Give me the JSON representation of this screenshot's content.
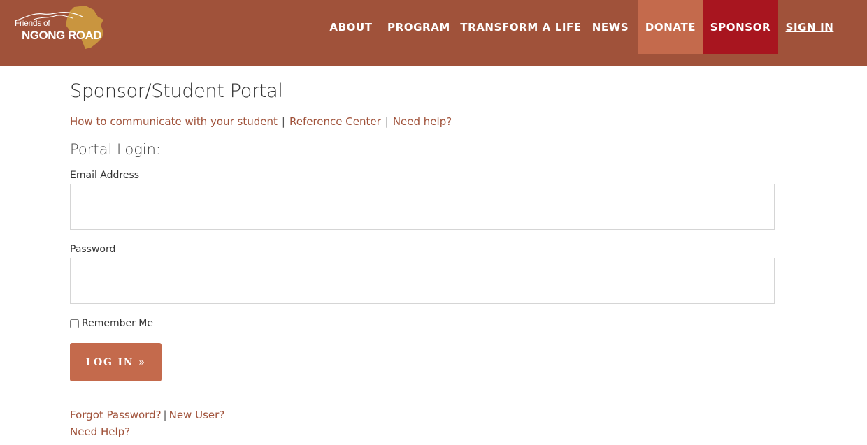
{
  "brand": {
    "line1": "Friends of",
    "line2": "NGONG ROAD",
    "colors": {
      "header": "#a0523a",
      "donate": "#c46a4c",
      "sponsor": "#a8151f",
      "logo_map": "#c9953f"
    }
  },
  "nav": {
    "items": [
      "ABOUT",
      "PROGRAM",
      "TRANSFORM A LIFE",
      "NEWS",
      "DONATE",
      "SPONSOR",
      "SIGN IN"
    ]
  },
  "page": {
    "title": "Sponsor/Student Portal",
    "links": [
      "How to communicate with your student",
      "Reference Center",
      "Need help?"
    ],
    "separator": "|"
  },
  "login": {
    "heading": "Portal Login:",
    "email_label": "Email Address",
    "email_value": "",
    "password_label": "Password",
    "password_value": "",
    "remember_label": "Remember Me",
    "remember_checked": false,
    "button_label": "LOG IN »"
  },
  "footer": {
    "forgot": "Forgot Password?",
    "new_user": "New User?",
    "need_help": "Need Help?",
    "separator": "|"
  }
}
